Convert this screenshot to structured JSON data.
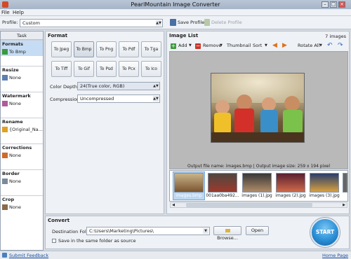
{
  "window": {
    "title": "PearlMountain Image Converter"
  },
  "menu": {
    "file": "File",
    "help": "Help"
  },
  "profile": {
    "label": "Profile:",
    "value": "Custom",
    "save": "Save Profile",
    "delete": "Delete Profile"
  },
  "task": {
    "header": "Task",
    "sections": [
      {
        "title": "Formats",
        "value": "To Bmp"
      },
      {
        "title": "Resize",
        "value": "None"
      },
      {
        "title": "Watermark",
        "value": "None"
      },
      {
        "title": "Rename",
        "value": "{Original_Na..."
      },
      {
        "title": "Corrections",
        "value": "None"
      },
      {
        "title": "Border",
        "value": "None"
      },
      {
        "title": "Crop",
        "value": "None"
      }
    ]
  },
  "format": {
    "header": "Format",
    "buttons": [
      "To Jpeg",
      "To Bmp",
      "To Png",
      "To Pdf",
      "To Tga",
      "To Tiff",
      "To Gif",
      "To Psd",
      "To Pcx",
      "To Ico"
    ],
    "selected": "To Bmp",
    "color_depth_label": "Color Depth:",
    "color_depth": "24(True color, RGB)",
    "compression_label": "Compression:",
    "compression": "Uncompressed"
  },
  "image_list": {
    "header": "Image List",
    "count": "7 images",
    "add": "Add",
    "remove": "Remove",
    "thumbnail": "Thumbnail",
    "sort": "Sort",
    "rotate_all": "Rotate All",
    "info": "Output file name: images.bmp | Output image size: 259 x 194 pixel",
    "thumbs": [
      "images.bmp",
      "001aa0ba492...",
      "images (1).jpg",
      "images (2).jpg",
      "images (3).jpg"
    ]
  },
  "convert": {
    "header": "Convert",
    "dest_label": "Destination Folder:",
    "dest_path": "C:\\Users\\Marketing\\Pictures\\",
    "browse": "Browse...",
    "open": "Open",
    "same_folder": "Save in the same folder as source",
    "start": "START"
  },
  "status": {
    "feedback": "Submit Feedback",
    "home": "Home Page"
  },
  "colors": {
    "accent": "#1d7fc7",
    "start": "#2a8fd6"
  }
}
